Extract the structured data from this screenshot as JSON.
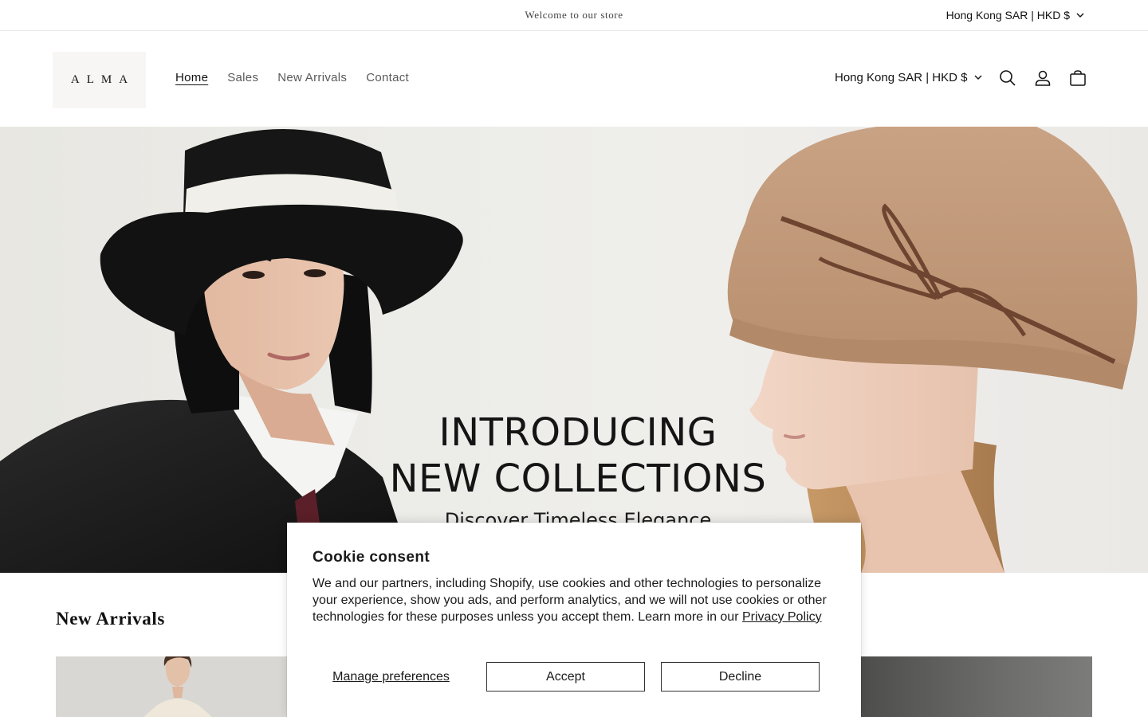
{
  "announcement": {
    "text": "Welcome to our store",
    "currency": "Hong Kong SAR | HKD $"
  },
  "header": {
    "logo_text": "ALMA",
    "nav": [
      {
        "label": "Home",
        "active": true
      },
      {
        "label": "Sales",
        "active": false
      },
      {
        "label": "New Arrivals",
        "active": false
      },
      {
        "label": "Contact",
        "active": false
      }
    ],
    "currency": "Hong Kong SAR | HKD $",
    "icons": [
      "search-icon",
      "account-icon",
      "cart-icon"
    ]
  },
  "hero": {
    "title_line1": "INTRODUCING",
    "title_line2": "NEW COLLECTIONS",
    "subtitle": "Discover Timeless Elegance"
  },
  "new_arrivals": {
    "title": "New Arrivals"
  },
  "cookie": {
    "title": "Cookie consent",
    "body": "We and our partners, including Shopify, use cookies and other technologies to personalize your experience, show you ads, and perform analytics, and we will not use cookies or other technologies for these purposes unless you accept them. Learn more in our",
    "privacy_link": "Privacy Policy",
    "manage_label": "Manage preferences",
    "accept_label": "Accept",
    "decline_label": "Decline"
  },
  "colors": {
    "text": "#121212",
    "muted": "#5a5a5a",
    "border": "#e6e6e6",
    "hat_black": "#141414",
    "hat_tan": "#c59c7b"
  }
}
